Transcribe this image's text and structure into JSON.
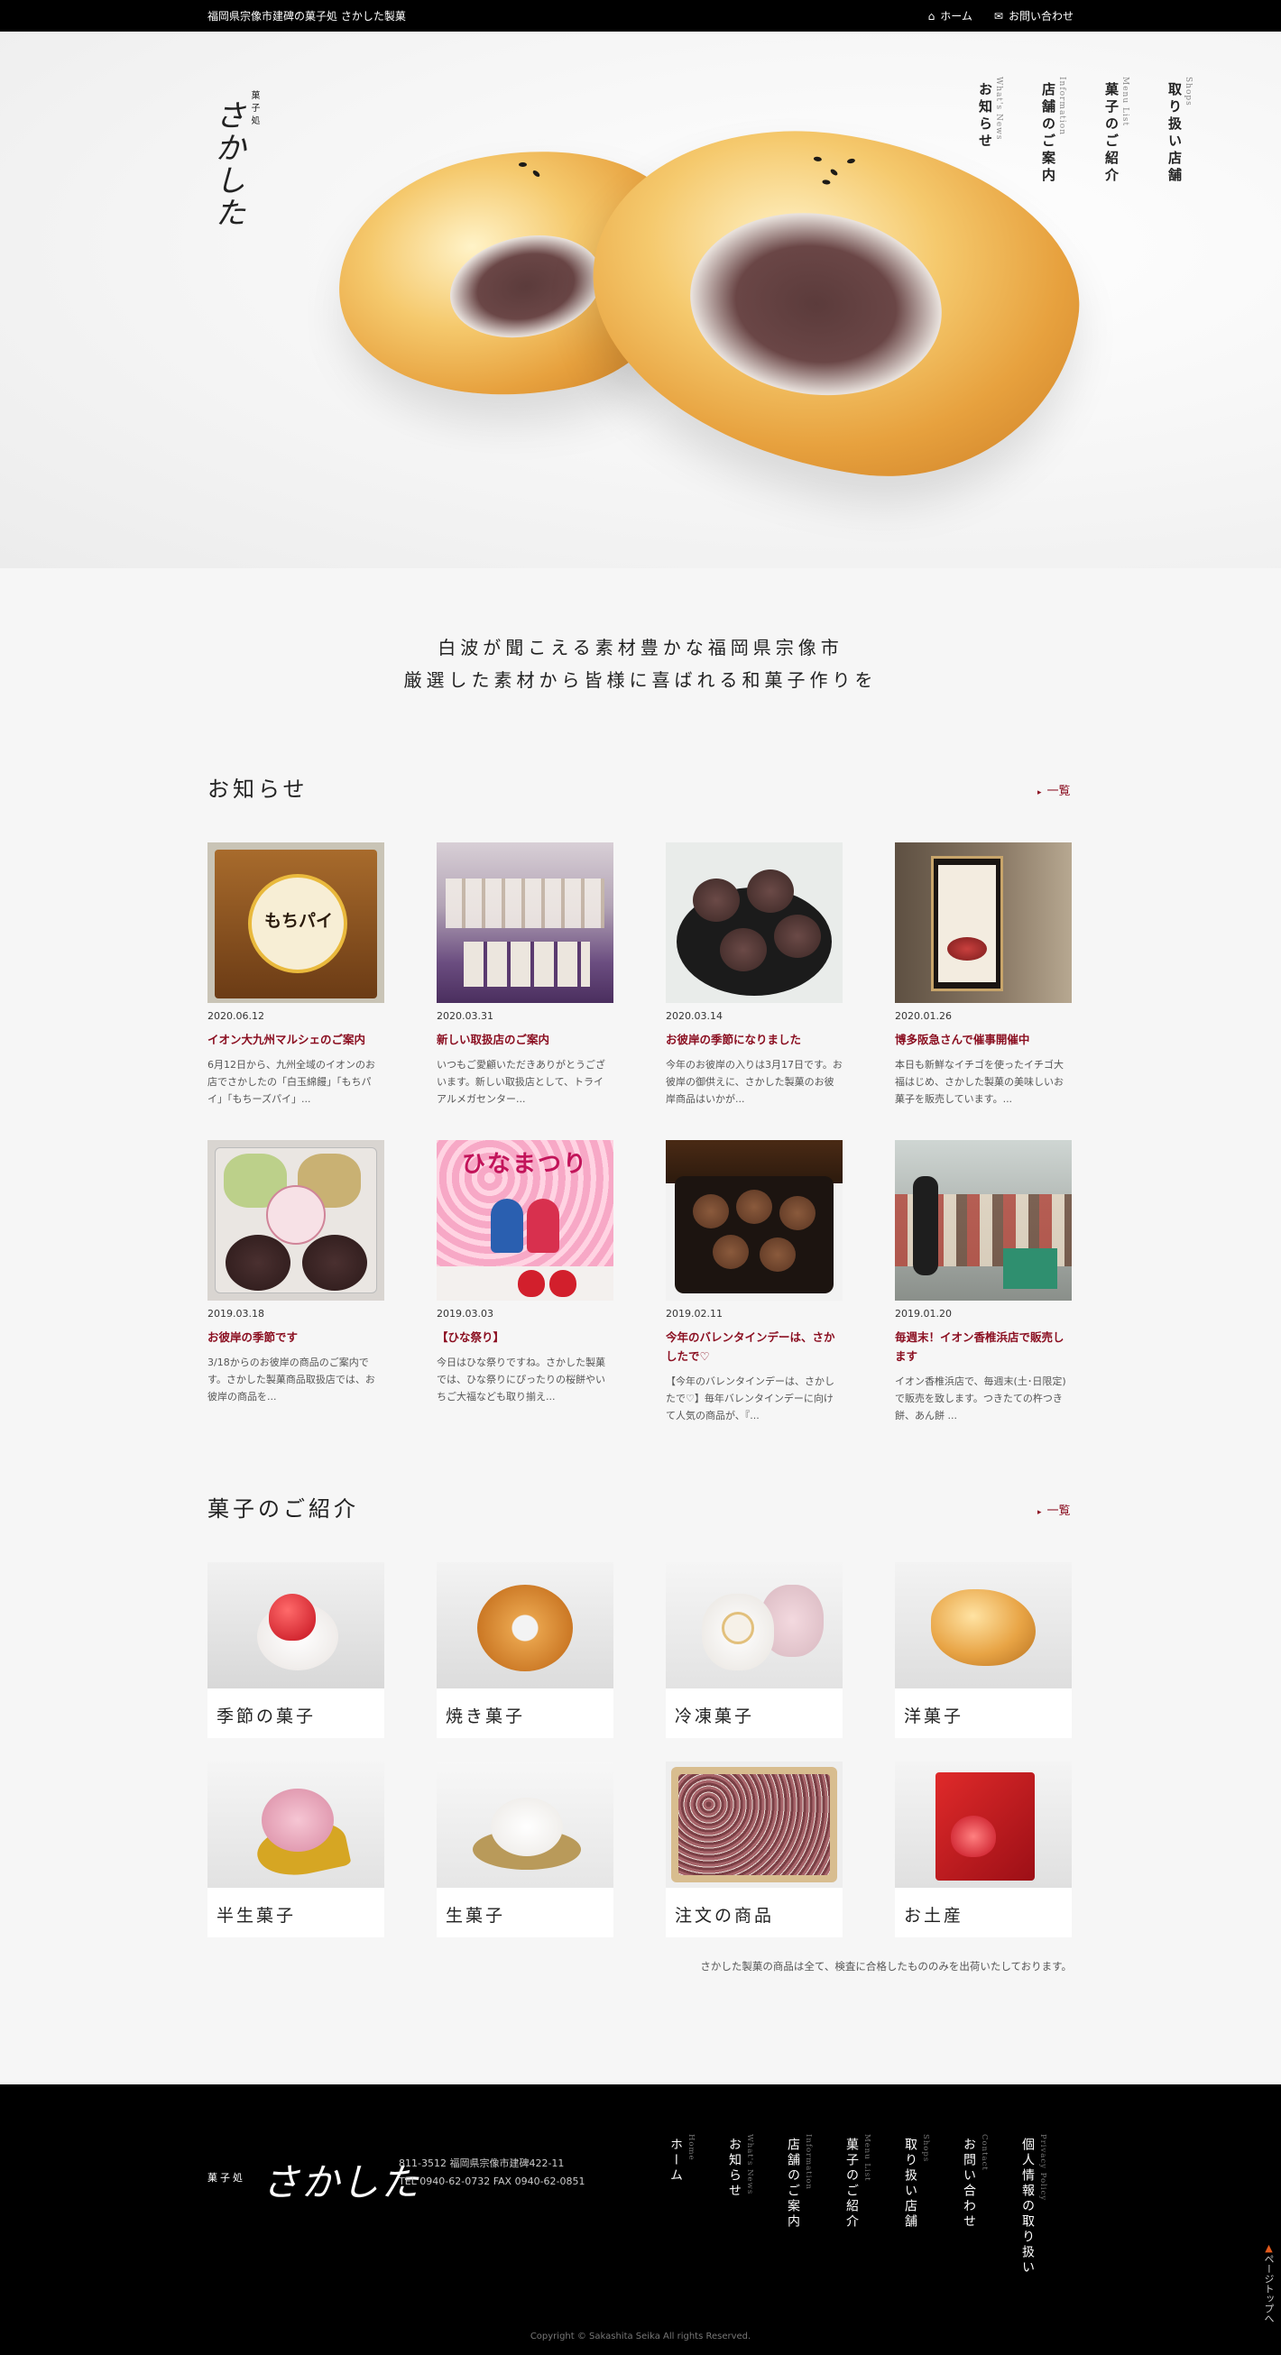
{
  "topbar": {
    "tagline": "福岡県宗像市建碑の菓子処 さかした製菓",
    "home_label": "ホーム",
    "contact_label": "お問い合わせ",
    "home_icon": "house-icon",
    "contact_icon": "envelope-icon"
  },
  "logo": {
    "sub": "菓子処",
    "main": "さかした"
  },
  "hero_nav": [
    {
      "en": "Shops",
      "jp": "取り扱い店舗"
    },
    {
      "en": "Menu List",
      "jp": "菓子のご紹介"
    },
    {
      "en": "Information",
      "jp": "店舗のご案内"
    },
    {
      "en": "What's News",
      "jp": "お知らせ"
    }
  ],
  "intro": {
    "line1": "白波が聞こえる素材豊かな福岡県宗像市",
    "line2": "厳選した素材から皆様に喜ばれる和菓子作りを"
  },
  "news": {
    "title": "お知らせ",
    "more_label": "一覧",
    "items": [
      {
        "date": "2020.06.12",
        "title": "イオン大九州マルシェのご案内",
        "excerpt": "6月12日から、九州全域のイオンのお店でさかしたの「白玉綿饅」「もちパイ」「もちーズパイ」..."
      },
      {
        "date": "2020.03.31",
        "title": "新しい取扱店のご案内",
        "excerpt": "いつもご愛顧いただきありがとうございます。新しい取扱店として、トライアルメガセンター..."
      },
      {
        "date": "2020.03.14",
        "title": "お彼岸の季節になりました",
        "excerpt": "今年のお彼岸の入りは3月17日です。お彼岸の御供えに、さかした製菓のお彼岸商品はいかが..."
      },
      {
        "date": "2020.01.26",
        "title": "博多阪急さんで催事開催中",
        "excerpt": "本日も新鮮なイチゴを使ったイチゴ大福はじめ、さかした製菓の美味しいお菓子を販売しています。..."
      },
      {
        "date": "2019.03.18",
        "title": "お彼岸の季節です",
        "excerpt": "3/18からのお彼岸の商品のご案内です。さかした製菓商品取扱店では、お彼岸の商品を..."
      },
      {
        "date": "2019.03.03",
        "title": "【ひな祭り】",
        "excerpt": "今日はひな祭りですね。さかした製菓では、ひな祭りにぴったりの桜餅やいちご大福なども取り揃え..."
      },
      {
        "date": "2019.02.11",
        "title": "今年のバレンタインデーは、さかしたで♡",
        "excerpt": "【今年のバレンタインデーは、さかしたで♡】毎年バレンタインデーに向けて人気の商品が、『..."
      },
      {
        "date": "2019.01.20",
        "title": "毎週末！イオン香椎浜店で販売します",
        "excerpt": "イオン香椎浜店で、毎週末(土･日限定)で販売を致します。つきたての杵つき餅、あん餅 ..."
      }
    ],
    "thumb_texts": {
      "mochi_pie": "もちパイ",
      "hina": "ひなまつり"
    }
  },
  "products": {
    "title": "菓子のご紹介",
    "more_label": "一覧",
    "items": [
      {
        "label": "季節の菓子"
      },
      {
        "label": "焼き菓子"
      },
      {
        "label": "冷凍菓子"
      },
      {
        "label": "洋菓子"
      },
      {
        "label": "半生菓子"
      },
      {
        "label": "生菓子"
      },
      {
        "label": "注文の商品"
      },
      {
        "label": "お土産"
      }
    ],
    "note": "さかした製菓の商品は全て、検査に合格したもののみを出荷いたしております。"
  },
  "footer": {
    "logo_sub": "菓子処",
    "logo_main": "さかした",
    "address": "811-3512 福岡県宗像市建碑422-11",
    "tel": "TEL 0940-62-0732  FAX 0940-62-0851",
    "nav": [
      {
        "en": "Home",
        "jp": "ホーム"
      },
      {
        "en": "What's News",
        "jp": "お知らせ"
      },
      {
        "en": "Information",
        "jp": "店舗のご案内"
      },
      {
        "en": "Menu List",
        "jp": "菓子のご紹介"
      },
      {
        "en": "Shops",
        "jp": "取り扱い店舗"
      },
      {
        "en": "Contact",
        "jp": "お問い合わせ"
      },
      {
        "en": "Privacy Policy",
        "jp": "個人情報の取り扱い"
      }
    ],
    "copyright": "Copyright © Sakashita Seika All rights Reserved.",
    "page_top": "ページトップへ"
  },
  "colors": {
    "accent": "#8b0f21",
    "footer_bg": "#000000",
    "page_bg": "#f6f6f6"
  }
}
